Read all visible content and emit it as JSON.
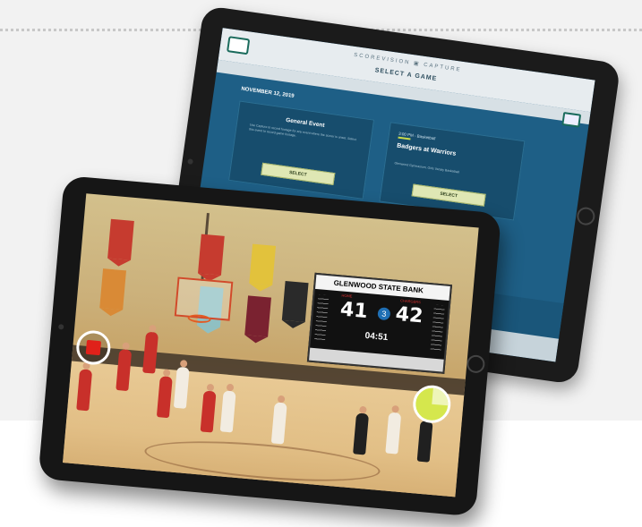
{
  "back_screen": {
    "brand": "SCOREVISION ▣ CAPTURE",
    "title": "SELECT A GAME",
    "date": "NOVEMBER 12, 2019",
    "cards": [
      {
        "title": "General Event",
        "description": "Use Capture to record footage for any event where the scorer is unset. Select this event to record game footage.",
        "button": "SELECT"
      },
      {
        "tag": "3:00 PM - Basketball",
        "name": "Badgers at Warriors",
        "subtitle": "Glenwood Gymnasium, Girls Varsity Basketball",
        "button": "SELECT"
      }
    ]
  },
  "scoreboard": {
    "brand": "GLENWOOD STATE BANK",
    "home_label": "HOME",
    "away_label": "CHARGERS",
    "home_score": "41",
    "away_score": "42",
    "period": "3",
    "clock": "04:51"
  },
  "controls": {
    "record_state": "recording",
    "timer_color": "#d5e74d",
    "record_color": "#e0211a"
  },
  "icons": {
    "home": "home-icon",
    "camera": "camera-icon",
    "record": "stop-record-icon",
    "timer": "timer-icon"
  }
}
